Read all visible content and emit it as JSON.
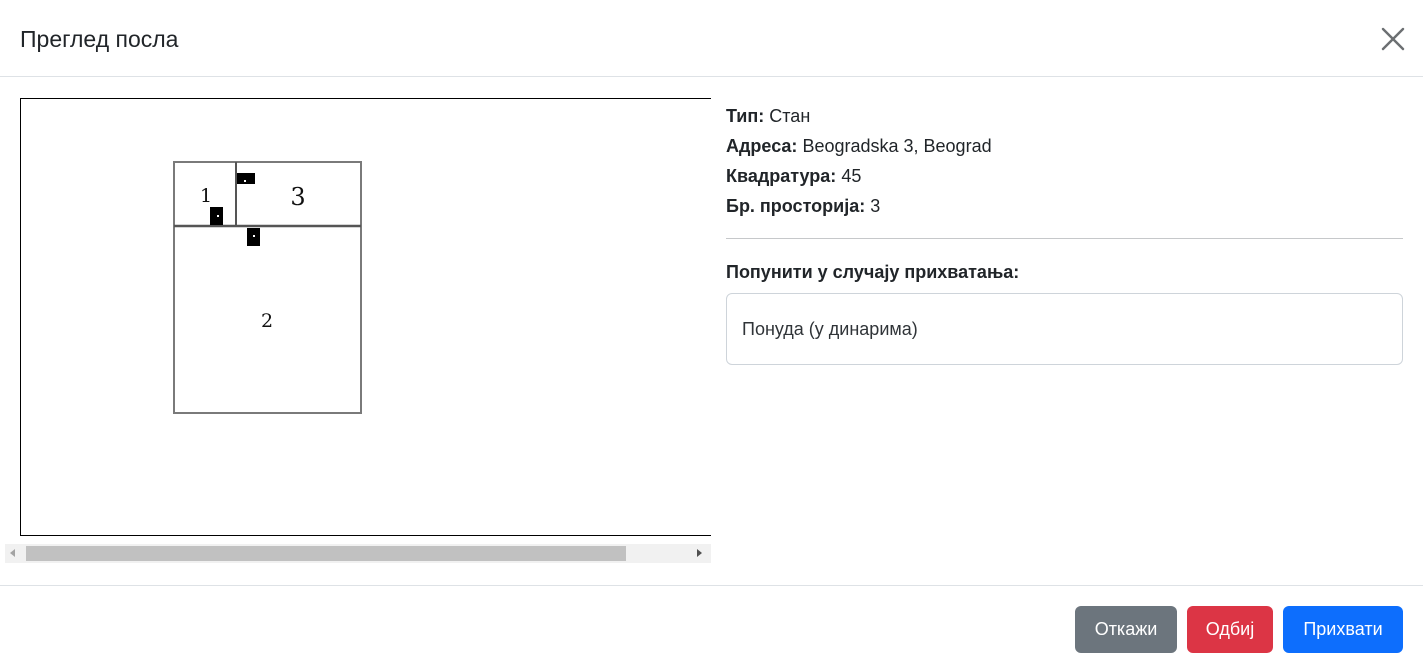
{
  "header": {
    "title": "Преглед посла",
    "close_icon": "close-icon"
  },
  "floorplan": {
    "rooms": [
      {
        "label": "1"
      },
      {
        "label": "3"
      },
      {
        "label": "2"
      }
    ],
    "door_icon": "door-icon"
  },
  "details": {
    "type_label": "Тип:",
    "type_value": "Стан",
    "address_label": "Адреса:",
    "address_value": "Beogradska 3, Beograd",
    "area_label": "Квадратура:",
    "area_value": "45",
    "rooms_label": "Бр. просторија:",
    "rooms_value": "3"
  },
  "acceptance": {
    "label": "Попунити у случају прихватања:",
    "offer_placeholder": "Понуда (у динарима)",
    "offer_value": ""
  },
  "footer": {
    "cancel_label": "Откажи",
    "reject_label": "Одбиј",
    "accept_label": "Прихвати"
  },
  "colors": {
    "secondary": "#6c757d",
    "danger": "#dc3545",
    "primary": "#0d6efd"
  }
}
